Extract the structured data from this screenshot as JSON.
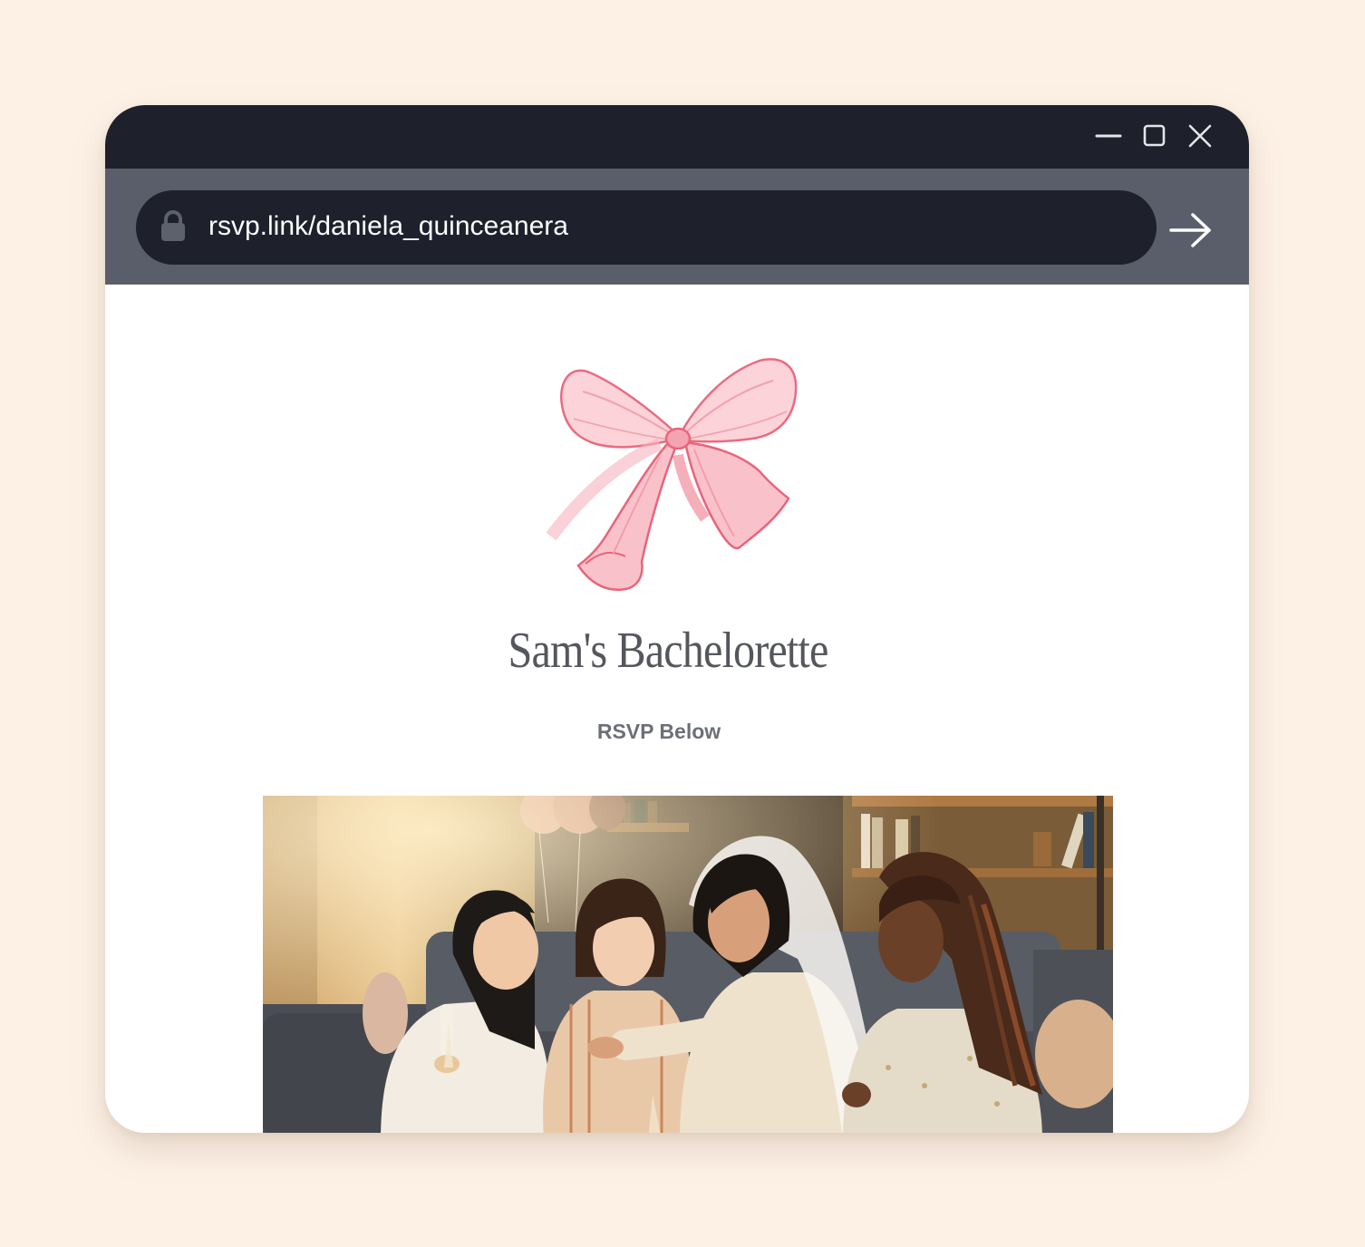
{
  "browser": {
    "url": "rsvp.link/daniela_quinceanera",
    "controls": [
      "minimize-icon",
      "maximize-icon",
      "close-icon"
    ],
    "go_icon": "arrow-right-icon",
    "lock_icon": "lock-icon"
  },
  "page": {
    "event_title": "Sam's Bachelorette",
    "rsvp_label": "RSVP Below",
    "hero_icon": "ribbon-bow-icon",
    "photo": "group-photo"
  },
  "colors": {
    "background": "#fdf1e6",
    "titlebar": "#1e202b",
    "toolbar": "#5a5e6b",
    "bow": "#f07a8c",
    "title_text": "#55575d"
  }
}
